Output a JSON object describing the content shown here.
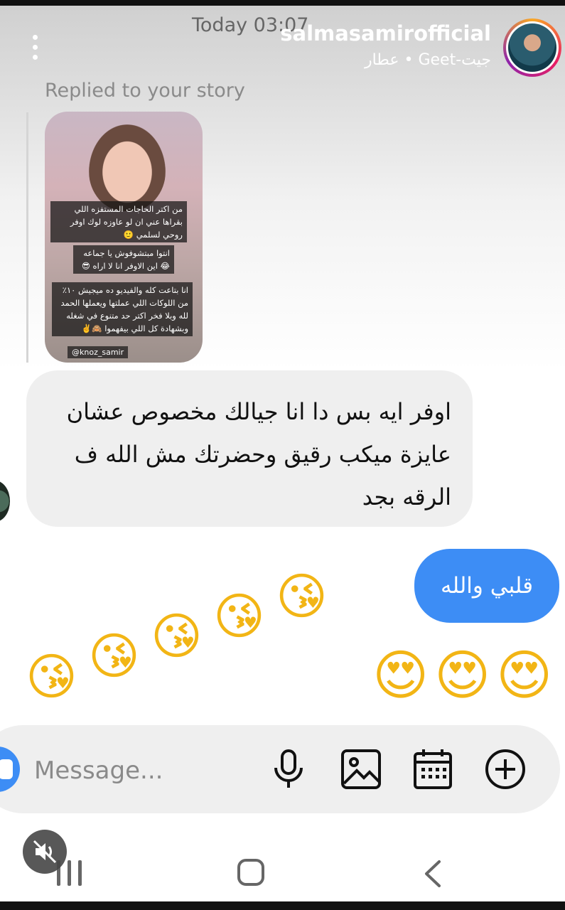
{
  "header": {
    "timestamp": "Today 03:07",
    "username": "salmasamirofficial",
    "subtitle": "عطار • Geet-جيت",
    "menu_icon": "more-vertical-icon"
  },
  "story_reply": {
    "label": "Replied to your story",
    "story_lines_1": "من اكتر الحاجات المستفزه اللي بقراها عني ان لو عاوزه لوك اوفر روحي لسلمي 🙂",
    "story_lines_2": "انتوا مبتشوفوش يا جماعه 😂 اين الاوفر انا لا اراه 😎",
    "story_lines_3": "انا بتاعت كله والفيديو ده ميجيش ١٠٪ من اللوكات اللي عملتها ويعملها الحمد لله وبلا فخر اكتر حد متنوع في شغله وبشهادة كل اللي بيفهموا 🙈✌️",
    "story_tag": "@knoz_samir"
  },
  "messages": {
    "incoming_text": "اوفر ايه بس دا انا جيالك مخصوص عشان عايزة ميكب رقيق وحضرتك مش الله ف الرقه بجد",
    "outgoing_text": "قلبي والله",
    "kiss_emoji": "😘",
    "heart_eyes_emoji": "😍"
  },
  "composer": {
    "placeholder": "Message...",
    "camera_icon": "camera-icon",
    "mic_icon": "microphone-icon",
    "gallery_icon": "image-icon",
    "sticker_icon": "calendar-icon",
    "plus_icon": "add-circle-icon"
  },
  "navbar": {
    "recents_icon": "recent-apps-icon",
    "home_icon": "home-icon",
    "back_icon": "back-icon",
    "mute_icon": "volume-mute-icon"
  },
  "colors": {
    "accent": "#3d8df5",
    "incoming_bubble": "#efefef"
  }
}
